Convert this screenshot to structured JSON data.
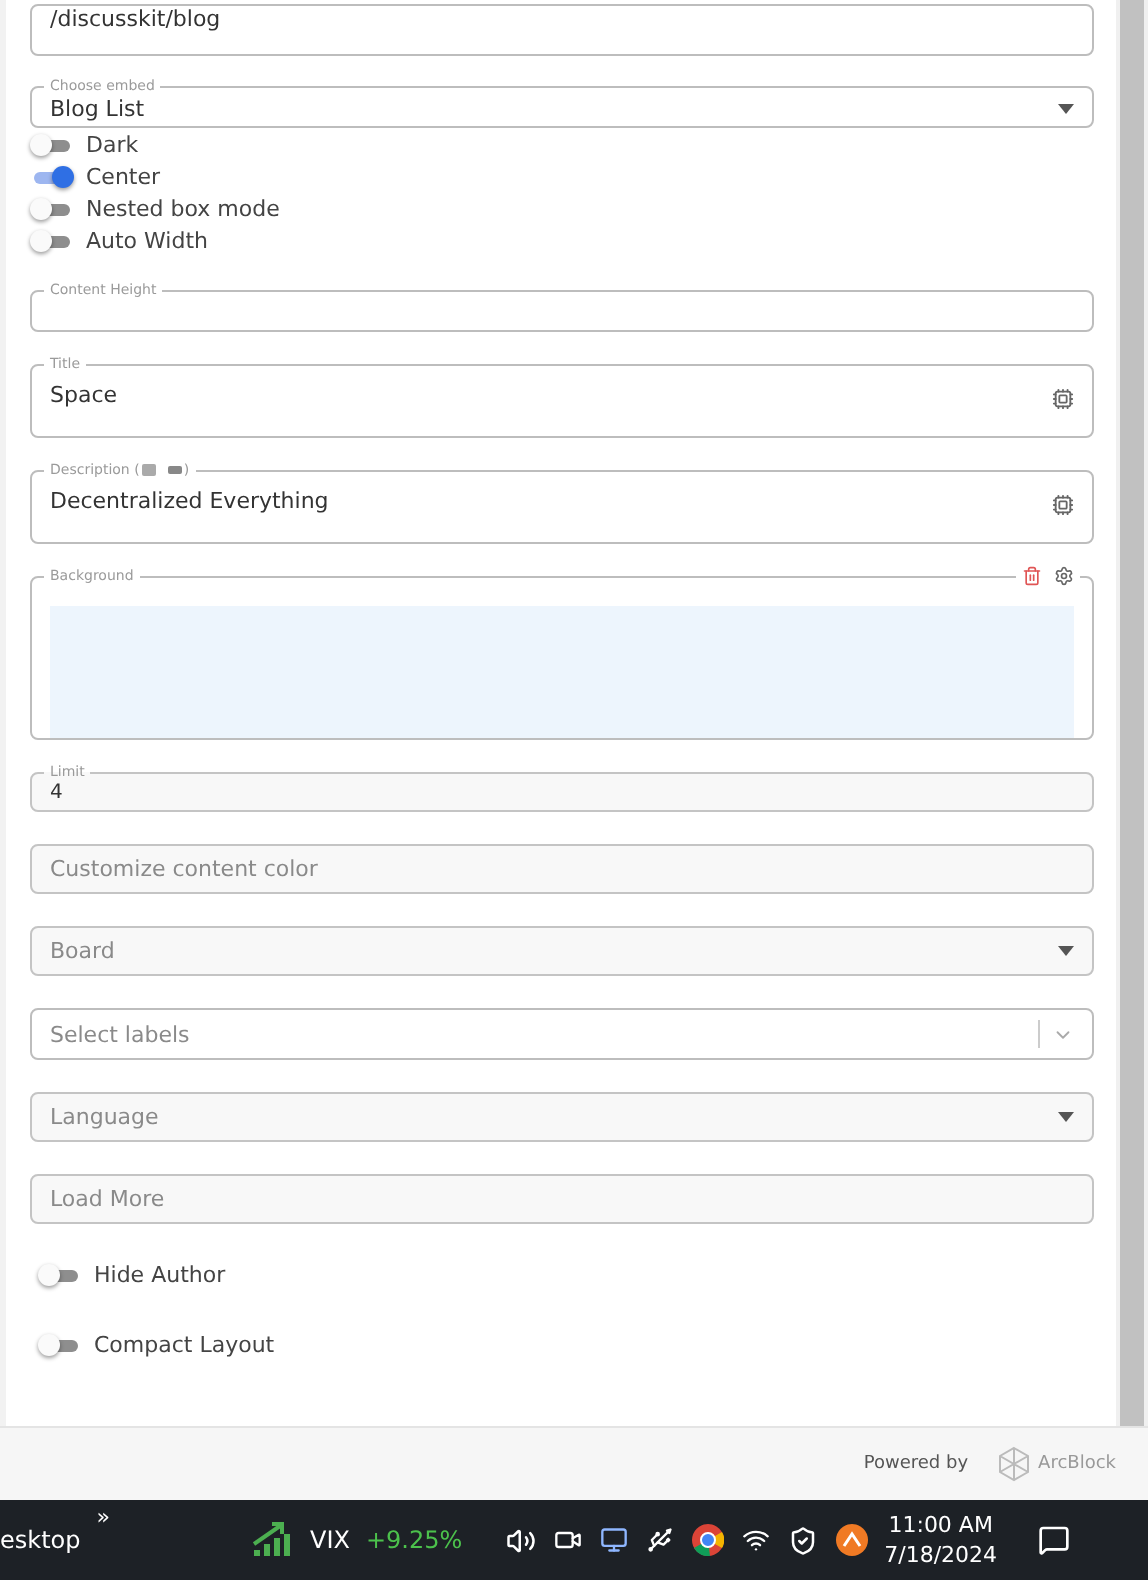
{
  "fields": [
    {
      "kind": "text",
      "value": "/discusskit/blog"
    },
    {
      "kind": "select",
      "label": "Choose embed",
      "value": "Blog List"
    },
    {
      "kind": "toggle",
      "label": "Dark",
      "on": false
    },
    {
      "kind": "toggle",
      "label": "Center",
      "on": true
    },
    {
      "kind": "toggle",
      "label": "Nested box mode",
      "on": false
    },
    {
      "kind": "toggle",
      "label": "Auto Width",
      "on": false
    },
    {
      "kind": "text",
      "label": "Content Height"
    },
    {
      "kind": "textarea",
      "label": "Title",
      "value": "Space"
    },
    {
      "kind": "textarea",
      "label": "Description (",
      "label_end": ")",
      "value": "Decentralized Everything"
    },
    {
      "kind": "image",
      "label": "Background"
    },
    {
      "kind": "filled",
      "label": "Limit",
      "value": "4"
    },
    {
      "kind": "filled",
      "placeholder": "Customize content color"
    },
    {
      "kind": "filled-select",
      "placeholder": "Board"
    },
    {
      "kind": "multi",
      "placeholder": "Select labels"
    },
    {
      "kind": "filled-select",
      "placeholder": "Language"
    },
    {
      "kind": "filled",
      "placeholder": "Load More"
    },
    {
      "kind": "toggle-spaced",
      "label": "Hide Author",
      "on": false
    },
    {
      "kind": "toggle-spaced",
      "label": "Compact Layout",
      "on": false
    }
  ],
  "footer": {
    "powered_by": "Powered by",
    "brand": "ArcBlock"
  },
  "taskbar": {
    "desktop": "esktop",
    "chevron": "»",
    "ticker": "VIX",
    "change": "+9.25%",
    "time": "11:00 AM",
    "date": "7/18/2024"
  }
}
